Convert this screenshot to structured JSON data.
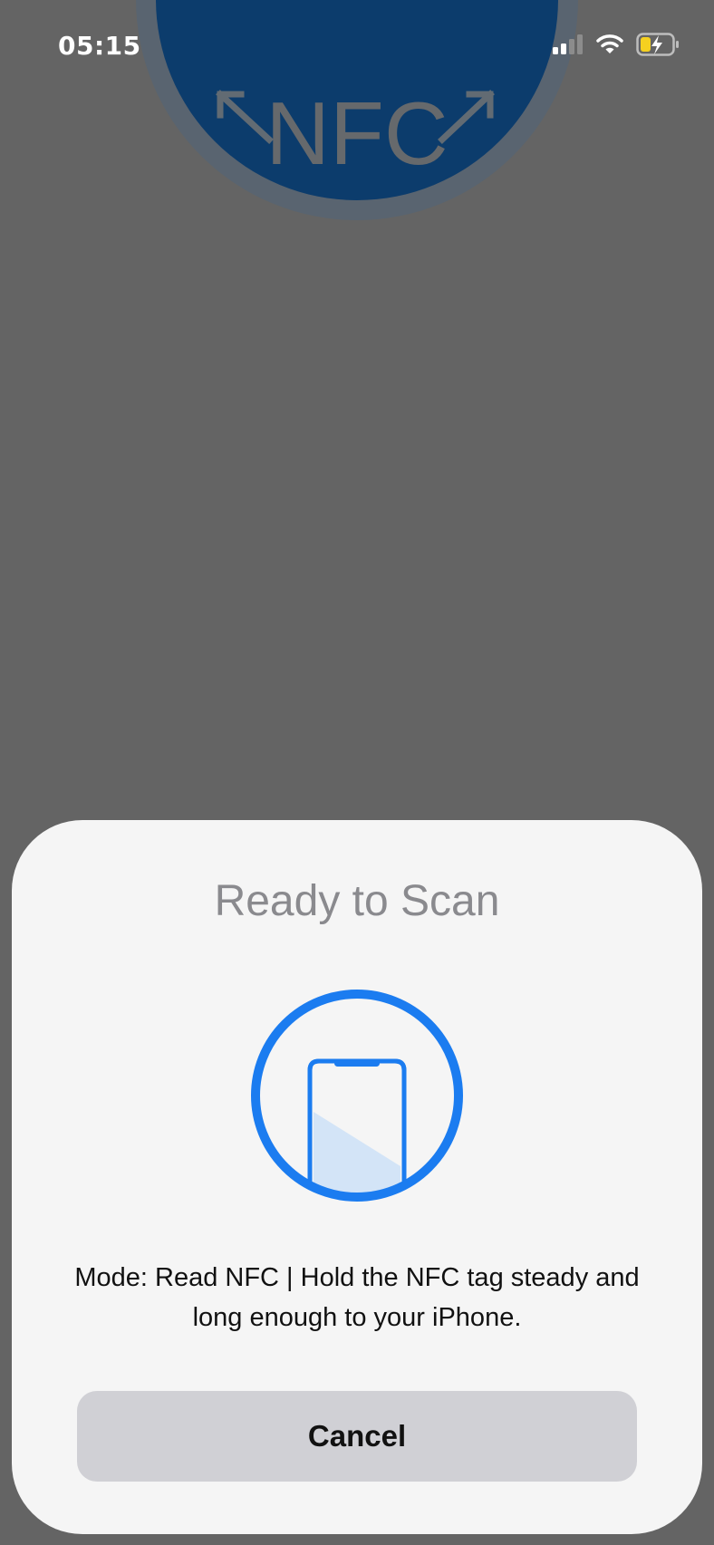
{
  "status_bar": {
    "time": "05:15",
    "icons": [
      "cellular-signal-icon",
      "wifi-icon",
      "battery-charging-icon"
    ]
  },
  "background": {
    "logo_text": "NFC",
    "logo_icon": "nfc-logo-icon"
  },
  "scan_sheet": {
    "title": "Ready to Scan",
    "illustration_icon": "phone-scan-icon",
    "message": "Mode: Read NFC | Hold the NFC tag steady and long enough to your iPhone.",
    "cancel_label": "Cancel"
  },
  "colors": {
    "dim_overlay": "#646464",
    "sheet": "#f5f5f5",
    "accent_blue": "#1b7cf0",
    "logo_blue": "#0c3c6c",
    "button": "#d0d0d5",
    "battery_yellow": "#f5d020"
  }
}
